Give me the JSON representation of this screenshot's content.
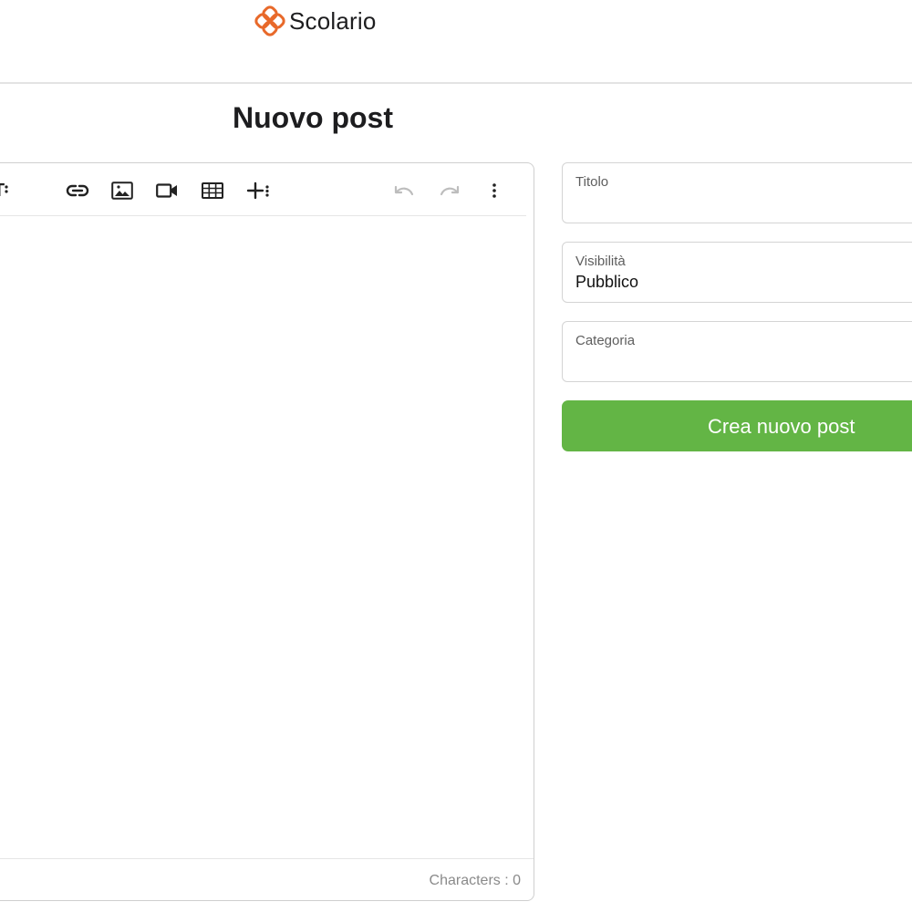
{
  "app": {
    "brand_name": "Scolario",
    "brand_color": "#e8692a"
  },
  "page": {
    "title": "Nuovo post"
  },
  "editor": {
    "toolbar": {
      "partial_format_label": "T",
      "tools": [
        {
          "name": "link-icon"
        },
        {
          "name": "image-icon"
        },
        {
          "name": "video-icon"
        },
        {
          "name": "table-icon"
        },
        {
          "name": "insert-more-icon"
        },
        {
          "name": "undo-icon",
          "disabled": true
        },
        {
          "name": "redo-icon",
          "disabled": true
        },
        {
          "name": "more-vertical-icon"
        }
      ]
    },
    "character_count_label": "Characters : 0"
  },
  "form": {
    "title_field": {
      "label": "Titolo",
      "value": ""
    },
    "visibility_field": {
      "label": "Visibilità",
      "value": "Pubblico"
    },
    "category_field": {
      "label": "Categoria",
      "value": ""
    },
    "submit_label": "Crea nuovo post",
    "submit_color": "#63b545"
  }
}
